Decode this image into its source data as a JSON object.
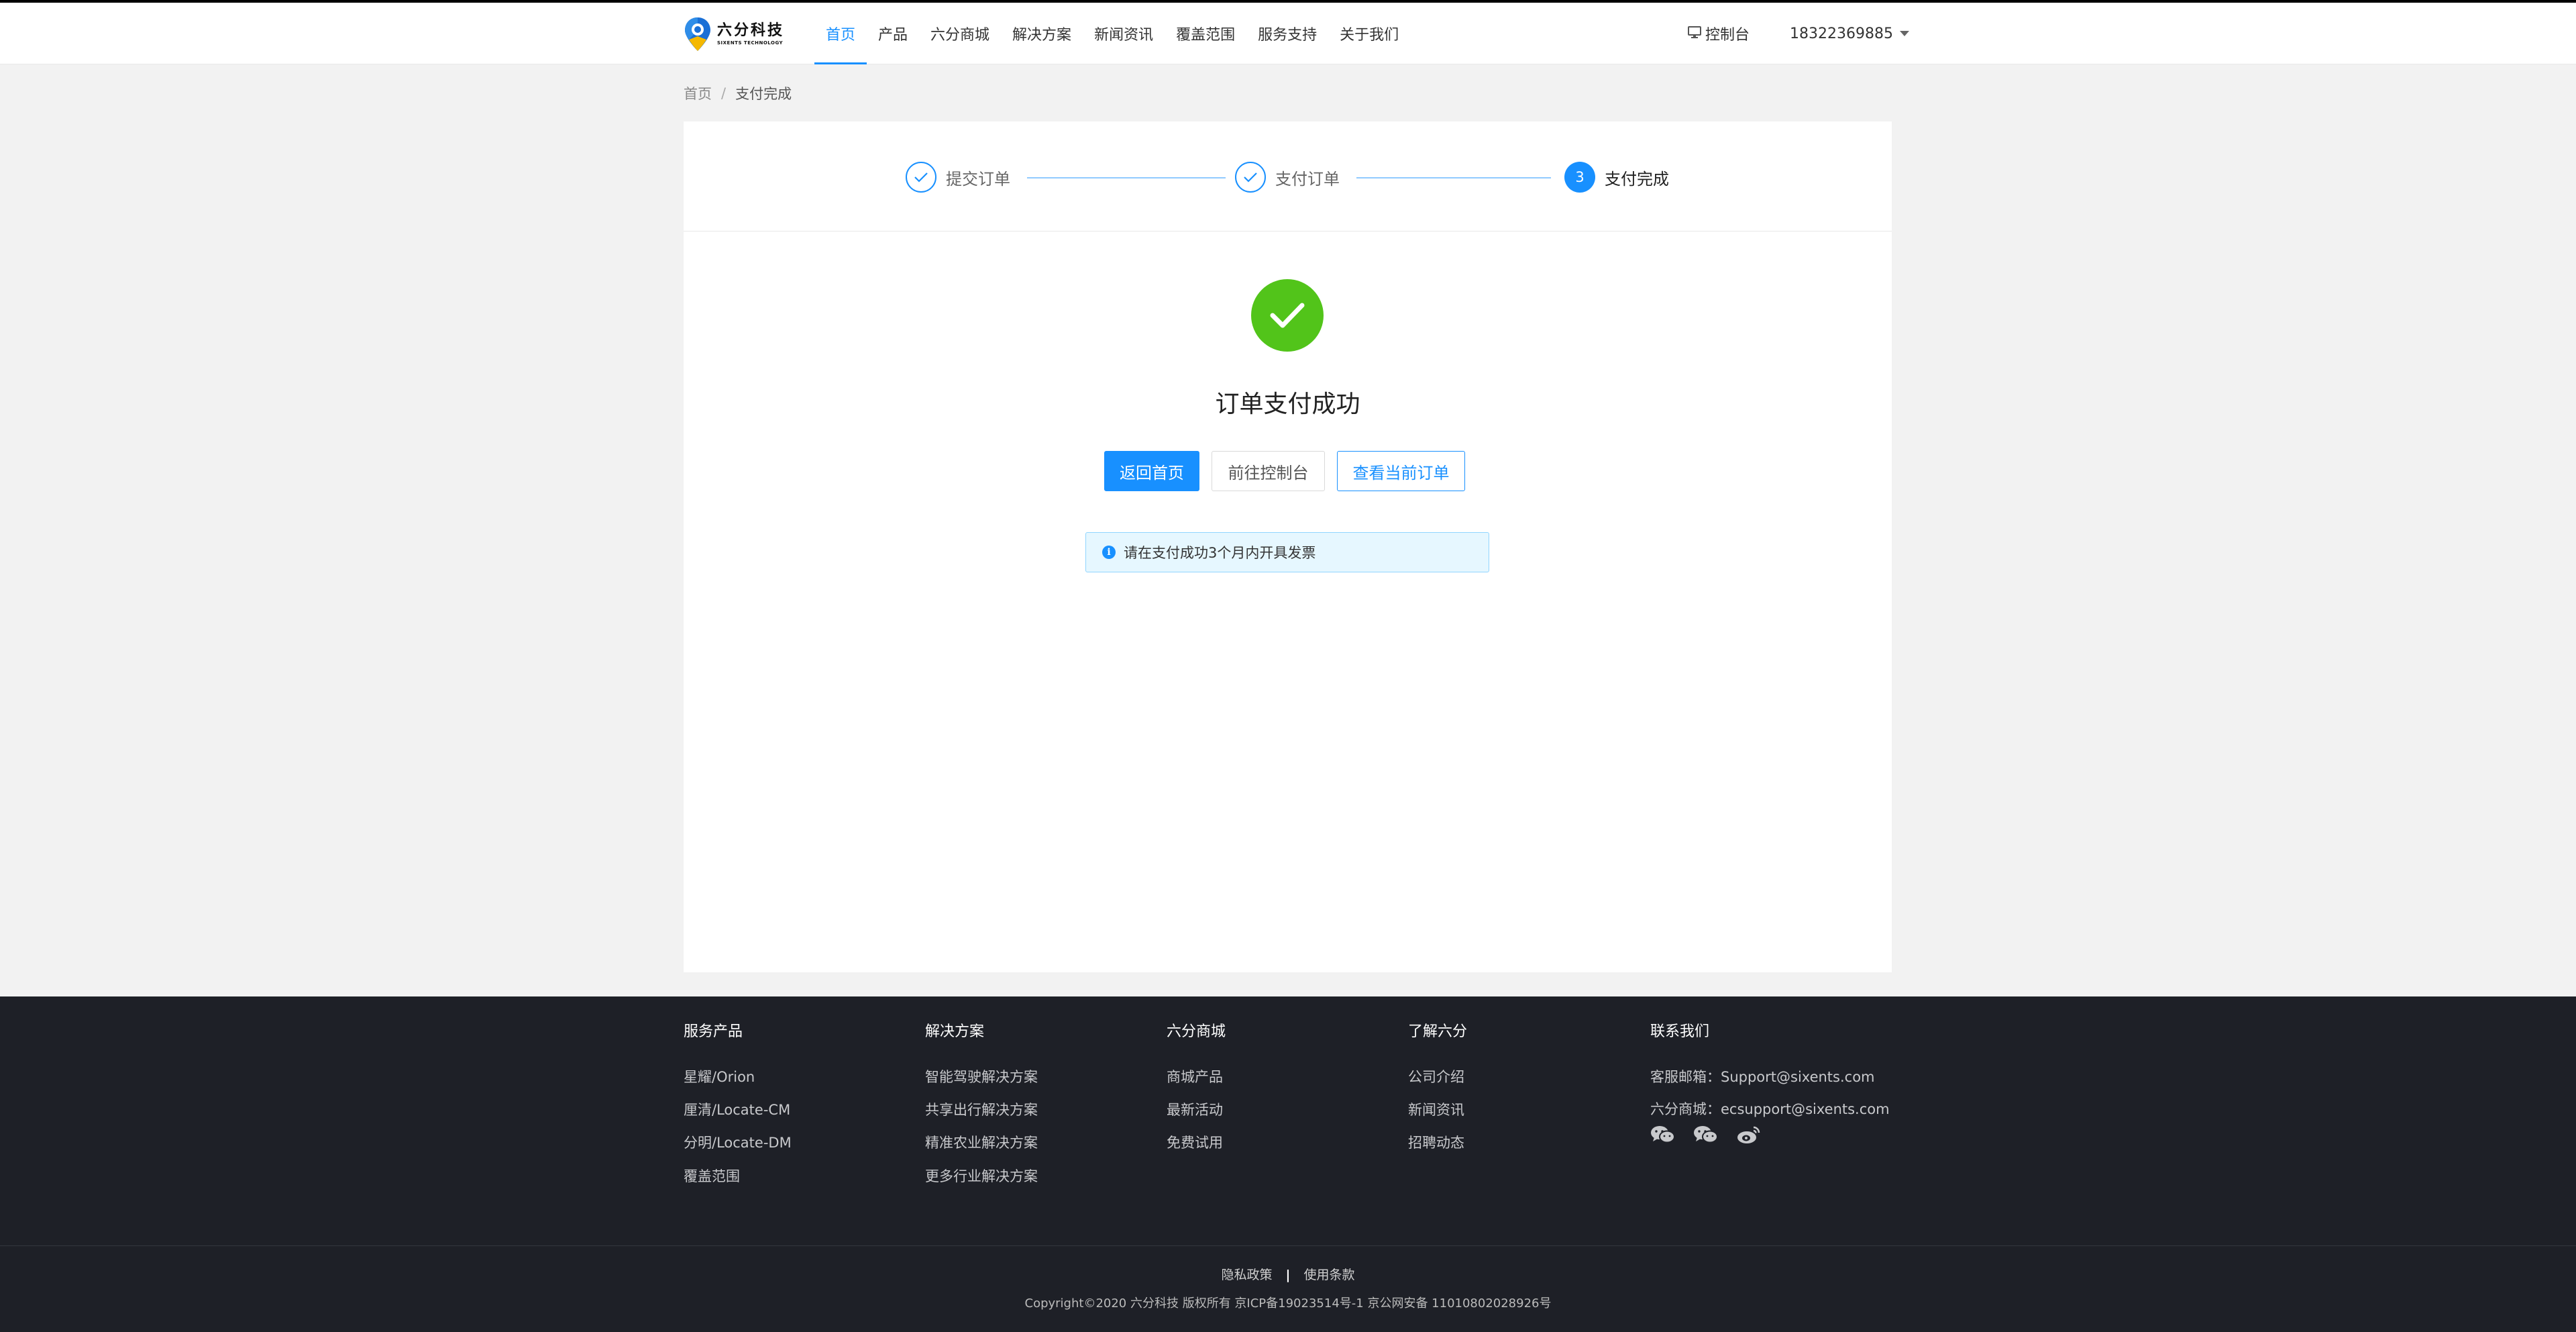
{
  "header": {
    "logo_cn": "六分科技",
    "logo_en": "SIXENTS TECHNOLOGY",
    "nav": [
      {
        "label": "首页",
        "active": true
      },
      {
        "label": "产品",
        "active": false
      },
      {
        "label": "六分商城",
        "active": false
      },
      {
        "label": "解决方案",
        "active": false
      },
      {
        "label": "新闻资讯",
        "active": false
      },
      {
        "label": "覆盖范围",
        "active": false
      },
      {
        "label": "服务支持",
        "active": false
      },
      {
        "label": "关于我们",
        "active": false
      }
    ],
    "console_label": "控制台",
    "user_phone": "18322369885"
  },
  "breadcrumb": {
    "home": "首页",
    "separator": "/",
    "current": "支付完成"
  },
  "steps": [
    {
      "label": "提交订单",
      "status": "done"
    },
    {
      "label": "支付订单",
      "status": "done"
    },
    {
      "label": "支付完成",
      "status": "active",
      "number": "3"
    }
  ],
  "result": {
    "title": "订单支付成功",
    "buttons": {
      "home": "返回首页",
      "console": "前往控制台",
      "view_order": "查看当前订单"
    },
    "notice": "请在支付成功3个月内开具发票"
  },
  "footer": {
    "columns": [
      {
        "title": "服务产品",
        "items": [
          "星耀/Orion",
          "厘清/Locate-CM",
          "分明/Locate-DM",
          "覆盖范围"
        ]
      },
      {
        "title": "解决方案",
        "items": [
          "智能驾驶解决方案",
          "共享出行解决方案",
          "精准农业解决方案",
          "更多行业解决方案"
        ]
      },
      {
        "title": "六分商城",
        "items": [
          "商城产品",
          "最新活动",
          "免费试用"
        ]
      },
      {
        "title": "了解六分",
        "items": [
          "公司介绍",
          "新闻资讯",
          "招聘动态"
        ]
      },
      {
        "title": "联系我们",
        "items": [
          "客服邮箱：Support@sixents.com",
          "六分商城：ecsupport@sixents.com"
        ]
      }
    ],
    "social_icons": [
      "wechat-icon",
      "wechat-icon",
      "weibo-icon"
    ],
    "links": {
      "privacy": "隐私政策",
      "separator": "|",
      "terms": "使用条款"
    },
    "copyright": "Copyright©2020 六分科技 版权所有 京ICP备19023514号-1 京公网安备 11010802028926号"
  },
  "colors": {
    "primary": "#1890ff",
    "success": "#52c41a",
    "footer_bg": "#1e2027",
    "alert_bg": "#e6f7ff"
  }
}
